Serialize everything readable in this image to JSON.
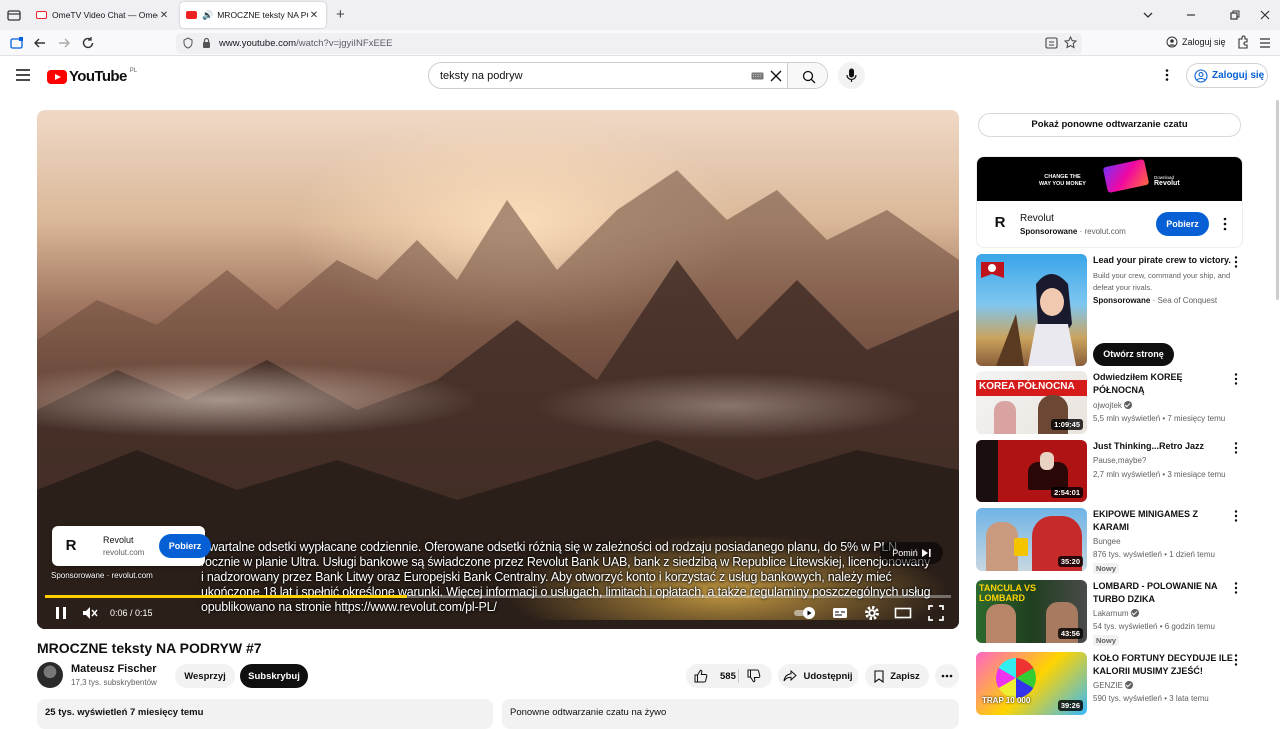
{
  "browser": {
    "tabs": [
      {
        "title": "OmeTV Video Chat — Omegle",
        "active": false
      },
      {
        "title": "MROCZNE teksty NA PODRYW",
        "active": true
      }
    ],
    "url_domain": "www.youtube.com",
    "url_path": "/watch?v=jgyiINFxEEE",
    "signin": "Zaloguj się"
  },
  "header": {
    "logo": "YouTube",
    "country": "PL",
    "search_query": "teksty na podryw",
    "signin": "Zaloguj się"
  },
  "player": {
    "subtitles": "Kwartalne odsetki wypłacane codziennie. Oferowane odsetki różnią się w zależności od rodzaju posiadanego planu, do 5% w PLN rocznie w planie Ultra. Usługi bankowe są świadczone przez Revolut Bank UAB, bank z siedzibą w Republice Litewskiej, licencjonowany i nadzorowany przez Bank Litwy oraz Europejski Bank Centralny. Aby otworzyć konto i korzystać z usług bankowych, należy mieć ukończone 18 lat i spełnić określone warunki. Więcej informacji o usługach, limitach i opłatach, a także regulaminy poszczególnych usług opublikowano na stronie https://www.revolut.com/pl-PL/",
    "ad_name": "Revolut",
    "ad_domain": "revolut.com",
    "ad_button": "Pobierz",
    "sponsored": "Sponsorowane · revolut.com",
    "skip": "Pomiń",
    "time": "0:06 / 0:15",
    "progress": 0.4
  },
  "video": {
    "title": "MROCZNE teksty NA PODRYW #7",
    "channel": "Mateusz Fischer",
    "subscribers": "17,3 tys. subskrybentów",
    "support": "Wesprzyj",
    "subscribe": "Subskrybuj",
    "likes": "585",
    "share": "Udostępnij",
    "save": "Zapisz",
    "views_date": "25 tys. wyświetleń  7 miesięcy temu",
    "chat_replay": "Ponowne odtwarzanie czatu na żywo"
  },
  "sidebar": {
    "replay_button": "Pokaż ponowne odtwarzanie czatu",
    "ad": {
      "banner_line1": "CHANGE THE",
      "banner_line2": "WAY YOU MONEY",
      "banner_small": "Download",
      "banner_brand": "Revolut",
      "name": "Revolut",
      "sponsored": "Sponsorowane",
      "domain": "revolut.com",
      "button": "Pobierz"
    },
    "promo": {
      "title": "Lead your pirate crew to victory.",
      "desc": "Build your crew, command your ship, and defeat your rivals.",
      "sponsored": "Sponsorowane",
      "advertiser": "Sea of Conquest",
      "cta": "Otwórz stronę"
    },
    "videos": [
      {
        "title": "Odwiedziłem KOREĘ PÓŁNOCNĄ",
        "channel": "ojwojtek",
        "meta": "5,5 mln wyświetleń • 7 miesięcy temu",
        "duration": "1:09:45",
        "thumb_text": "KOREA PÓŁNOCNA",
        "new": ""
      },
      {
        "title": "Just Thinking...Retro Jazz",
        "channel": "Pause,maybe?",
        "meta": "2,7 mln wyświetleń • 3 miesiące temu",
        "duration": "2:54:01",
        "thumb_text": "",
        "new": ""
      },
      {
        "title": "EKIPOWE MINIGAMES Z KARAMI",
        "channel": "Bungee",
        "meta": "876 tys. wyświetleń • 1 dzień temu",
        "duration": "35:20",
        "thumb_text": "",
        "new": "Nowy"
      },
      {
        "title": "LOMBARD - POLOWANIE NA TURBO DZIKA",
        "channel": "Lakarnum",
        "meta": "54 tys. wyświetleń • 6 godzin temu",
        "duration": "43:56",
        "thumb_text": "TANCULA VS LOMBARD",
        "new": "Nowy"
      },
      {
        "title": "KOŁO FORTUNY DECYDUJE ILE KALORII MUSIMY ZJEŚĆ!",
        "channel": "GENZIE",
        "meta": "590 tys. wyświetleń • 3 lata temu",
        "duration": "39:26",
        "thumb_text": "TRAP 10 000",
        "new": ""
      }
    ]
  }
}
